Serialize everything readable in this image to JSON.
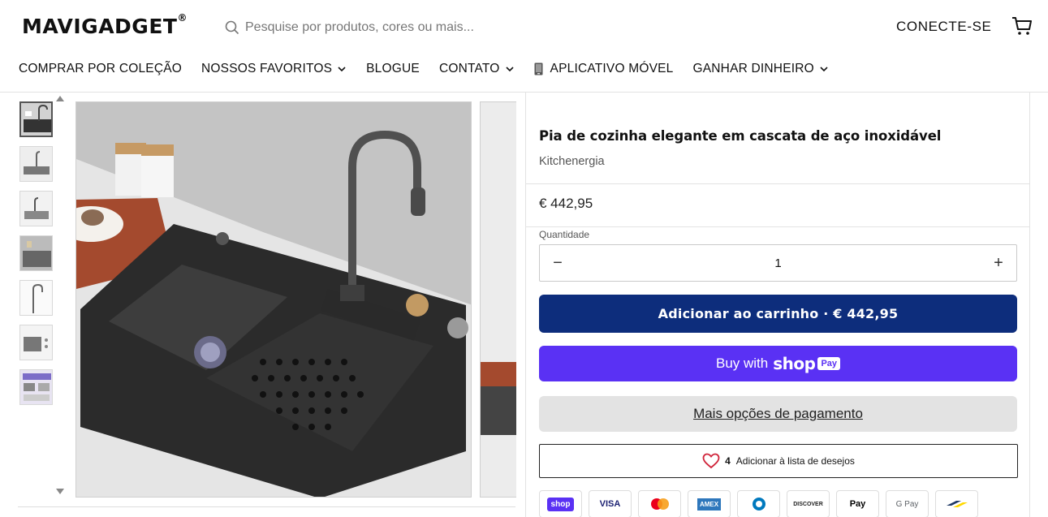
{
  "header": {
    "logo": "MAVIGADGET",
    "logo_mark": "®",
    "search_placeholder": "Pesquise por produtos, cores ou mais...",
    "login": "CONECTE-SE",
    "cart_icon": "cart-icon"
  },
  "nav": {
    "items": [
      {
        "label": "COMPRAR POR COLEÇÃO",
        "dropdown": false
      },
      {
        "label": "NOSSOS FAVORITOS",
        "dropdown": true
      },
      {
        "label": "BLOGUE",
        "dropdown": false
      },
      {
        "label": "CONTATO",
        "dropdown": true
      },
      {
        "label": "APLICATIVO MÓVEL",
        "dropdown": false,
        "icon": "phone-icon"
      },
      {
        "label": "GANHAR DINHEIRO",
        "dropdown": true
      }
    ]
  },
  "gallery": {
    "thumb_count": 7,
    "active_index": 0
  },
  "product": {
    "title": "Pia de cozinha elegante em cascata de aço inoxidável",
    "vendor": "Kitchenergia",
    "price": "€ 442,95",
    "quantity_label": "Quantidade",
    "quantity": "1",
    "minus": "−",
    "plus": "+",
    "add_to_cart": "Adicionar ao carrinho · € 442,95",
    "buy_with": "Buy with",
    "shop_word": "shop",
    "pay_word": "Pay",
    "more_payment": "Mais opções de pagamento",
    "wishlist_count": "4",
    "wishlist_label": "Adicionar à lista de desejos"
  },
  "payments": {
    "shop": "shop",
    "visa": "VISA",
    "amex": "AMEX",
    "discover": "DISCOVER",
    "applepay": "Pay",
    "gpay": "G Pay"
  },
  "colors": {
    "add_to_cart_bg": "#0d2d7c",
    "shop_pay_bg": "#5a31f4",
    "more_pay_bg": "#e3e3e3"
  }
}
